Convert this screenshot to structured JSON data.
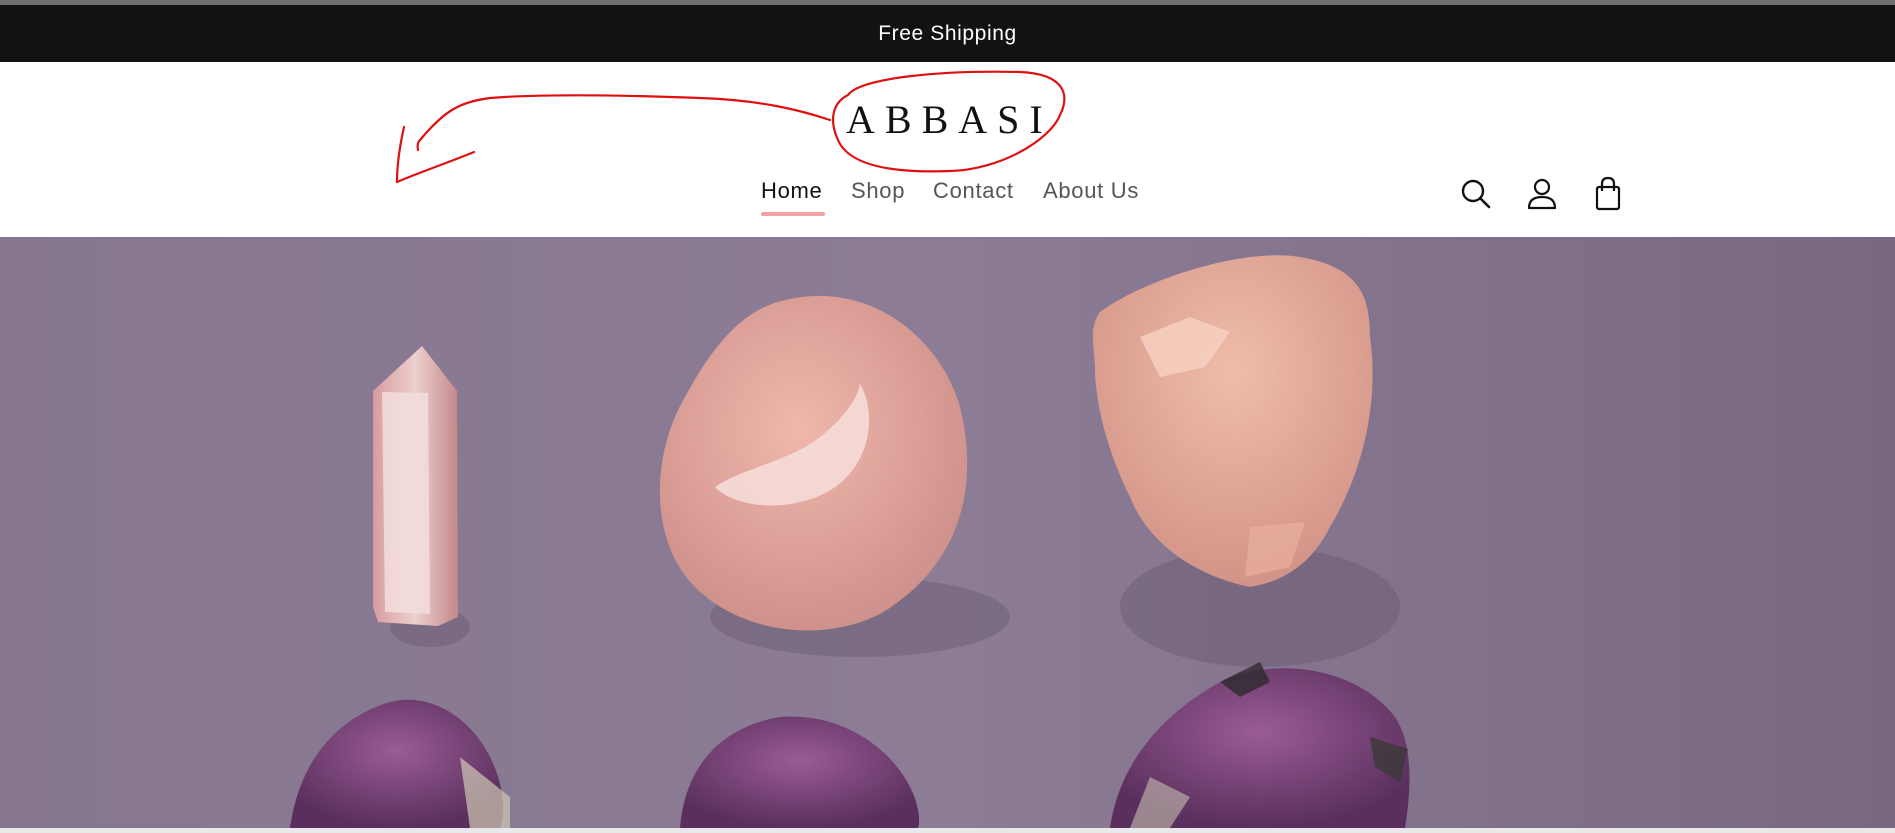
{
  "announcement": {
    "text": "Free Shipping"
  },
  "brand": {
    "name": "ABBASI"
  },
  "nav": {
    "items": [
      {
        "label": "Home",
        "active": true
      },
      {
        "label": "Shop",
        "active": false
      },
      {
        "label": "Contact",
        "active": false
      },
      {
        "label": "About Us",
        "active": false
      }
    ]
  },
  "header_icons": [
    "search-icon",
    "account-icon",
    "cart-icon"
  ],
  "colors": {
    "announcement_bg": "#121212",
    "nav_active_underline": "#f2a3a3",
    "annotation_stroke": "#e01010",
    "hero_background": "#7d6b84"
  }
}
